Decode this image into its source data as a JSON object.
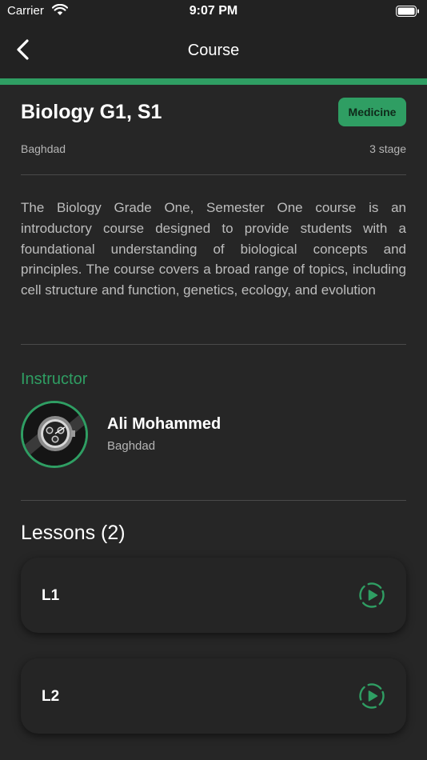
{
  "status_bar": {
    "carrier": "Carrier",
    "time": "9:07 PM"
  },
  "nav": {
    "title": "Course"
  },
  "course": {
    "title": "Biology G1, S1",
    "category": "Medicine",
    "city": "Baghdad",
    "stage": "3 stage",
    "description": "The Biology Grade One, Semester One course is an introductory course designed to provide students with a foundational understanding of biological concepts and principles. The course covers a broad range of topics, including cell structure and function, genetics, ecology, and evolution"
  },
  "instructor": {
    "section_label": "Instructor",
    "name": "Ali Mohammed",
    "city": "Baghdad"
  },
  "lessons": {
    "heading": "Lessons (2)",
    "items": [
      {
        "label": "L1",
        "icon": "play-circle-icon"
      },
      {
        "label": "L2",
        "icon": "play-circle-icon"
      }
    ]
  },
  "colors": {
    "accent": "#2f9e63",
    "background": "#262626",
    "bar": "#222222"
  }
}
